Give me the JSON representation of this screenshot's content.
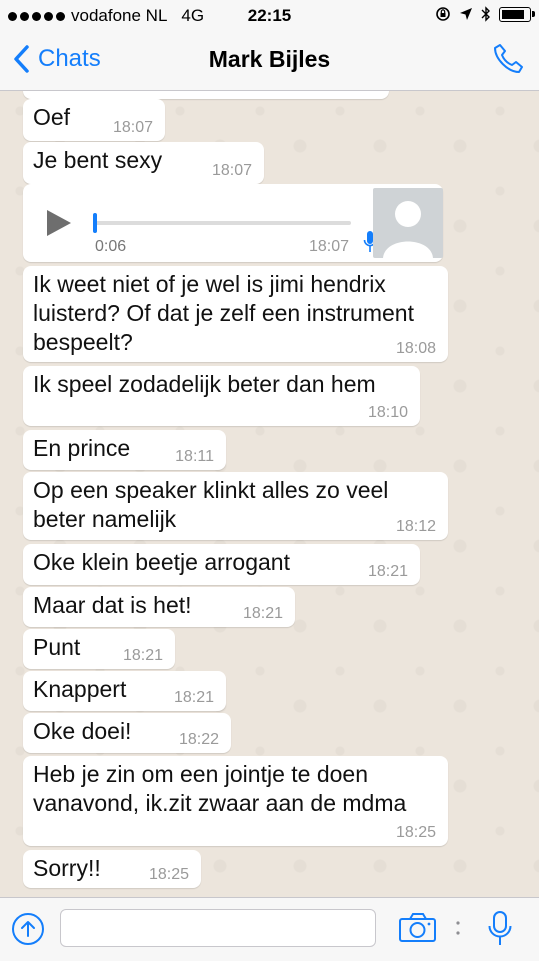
{
  "status": {
    "carrier": "vodafone NL",
    "network": "4G",
    "time": "22:15",
    "battery_level": 0.85
  },
  "nav": {
    "back_label": "Chats",
    "title": "Mark Bijles"
  },
  "voice_message": {
    "duration": "0:06",
    "time": "18:07",
    "progress": 0
  },
  "messages": [
    {
      "text": "Oef",
      "time": "18:07"
    },
    {
      "text": "Je bent sexy",
      "time": "18:07"
    },
    {
      "text": "Ik weet niet of je wel is jimi hendrix luisterd? Of dat je zelf een instrument bespeelt?",
      "time": "18:08"
    },
    {
      "text": "Ik speel zodadelijk beter dan hem",
      "time": "18:10"
    },
    {
      "text": "En prince",
      "time": "18:11"
    },
    {
      "text": "Op een speaker klinkt alles zo veel beter namelijk",
      "time": "18:12"
    },
    {
      "text": "Oke klein beetje arrogant",
      "time": "18:21"
    },
    {
      "text": "Maar dat is het!",
      "time": "18:21"
    },
    {
      "text": "Punt",
      "time": "18:21"
    },
    {
      "text": "Knappert",
      "time": "18:21"
    },
    {
      "text": "Oke doei!",
      "time": "18:22"
    },
    {
      "text": "Heb je zin om een jointje te doen vanavond, ik.zit zwaar aan de mdma",
      "time": "18:25"
    },
    {
      "text": "Sorry!!",
      "time": "18:25"
    }
  ],
  "input": {
    "placeholder": ""
  },
  "colors": {
    "accent": "#147efb",
    "bubble": "#ffffff",
    "chat_background": "#ece5dc"
  }
}
